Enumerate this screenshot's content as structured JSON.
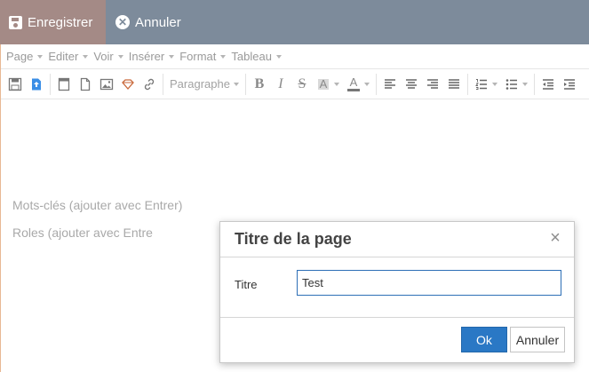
{
  "topbar": {
    "save_label": "Enregistrer",
    "cancel_label": "Annuler",
    "save_bg": "#a48a86",
    "bar_bg": "#7d8b9b"
  },
  "menubar": {
    "items": [
      "Page",
      "Editer",
      "Voir",
      "Insérer",
      "Format",
      "Tableau"
    ]
  },
  "toolbar": {
    "format_select": "Paragraphe",
    "bold_glyph": "B",
    "italic_glyph": "I",
    "strike_glyph": "S",
    "bg_color_glyph": "A",
    "text_color_glyph": "A",
    "icons": [
      "save-icon",
      "upload-icon",
      "template-icon",
      "new-document-icon",
      "image-icon",
      "gem-icon",
      "link-icon",
      "align-left-icon",
      "align-center-icon",
      "align-right-icon",
      "align-justify-icon",
      "numbered-list-icon",
      "bullet-list-icon",
      "outdent-icon",
      "indent-icon"
    ]
  },
  "content": {
    "keywords_placeholder": "Mots-clés (ajouter avec Entrer)",
    "roles_placeholder": "Roles (ajouter avec Entre"
  },
  "modal": {
    "title": "Titre de la page",
    "close_glyph": "×",
    "field_label": "Titre",
    "field_value": "Test",
    "ok_label": "Ok",
    "cancel_label": "Annuler",
    "accent": "#2a78c5"
  }
}
